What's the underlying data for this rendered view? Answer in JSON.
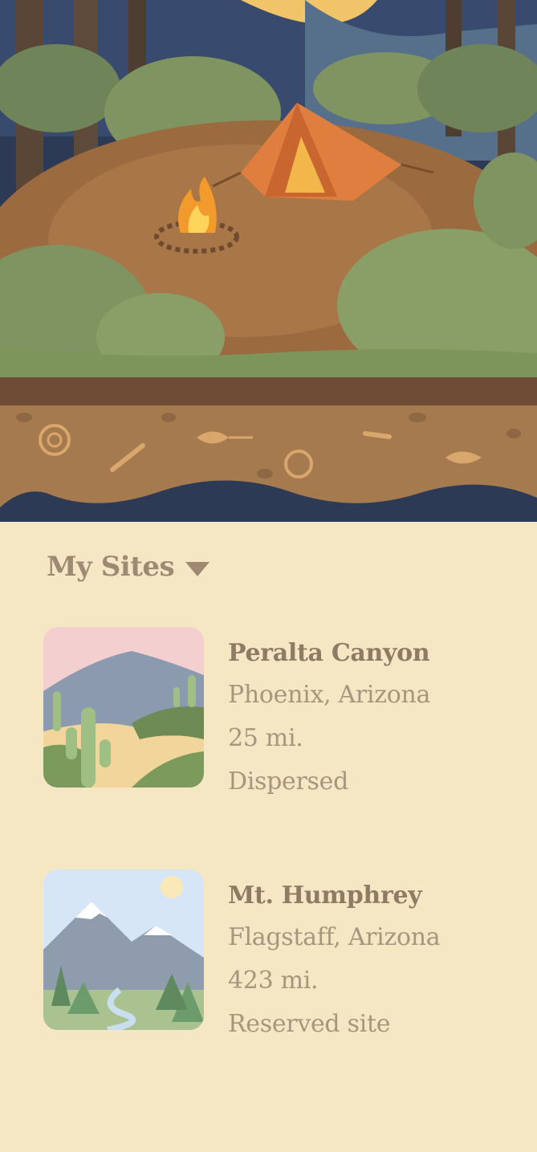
{
  "section": {
    "title": "My Sites"
  },
  "sites": [
    {
      "name": "Peralta Canyon",
      "location": "Phoenix, Arizona",
      "distance": "25 mi.",
      "type": "Dispersed"
    },
    {
      "name": "Mt. Humphrey",
      "location": "Flagstaff, Arizona",
      "distance": "423 mi.",
      "type": "Reserved site"
    }
  ],
  "colors": {
    "background": "#f5e6c4",
    "title": "#9e8a73",
    "text": "#a8957e",
    "dirt": "#a57a4f",
    "foliage": "#8a9a5b"
  },
  "icons": {
    "caret": "caret-down-icon"
  }
}
